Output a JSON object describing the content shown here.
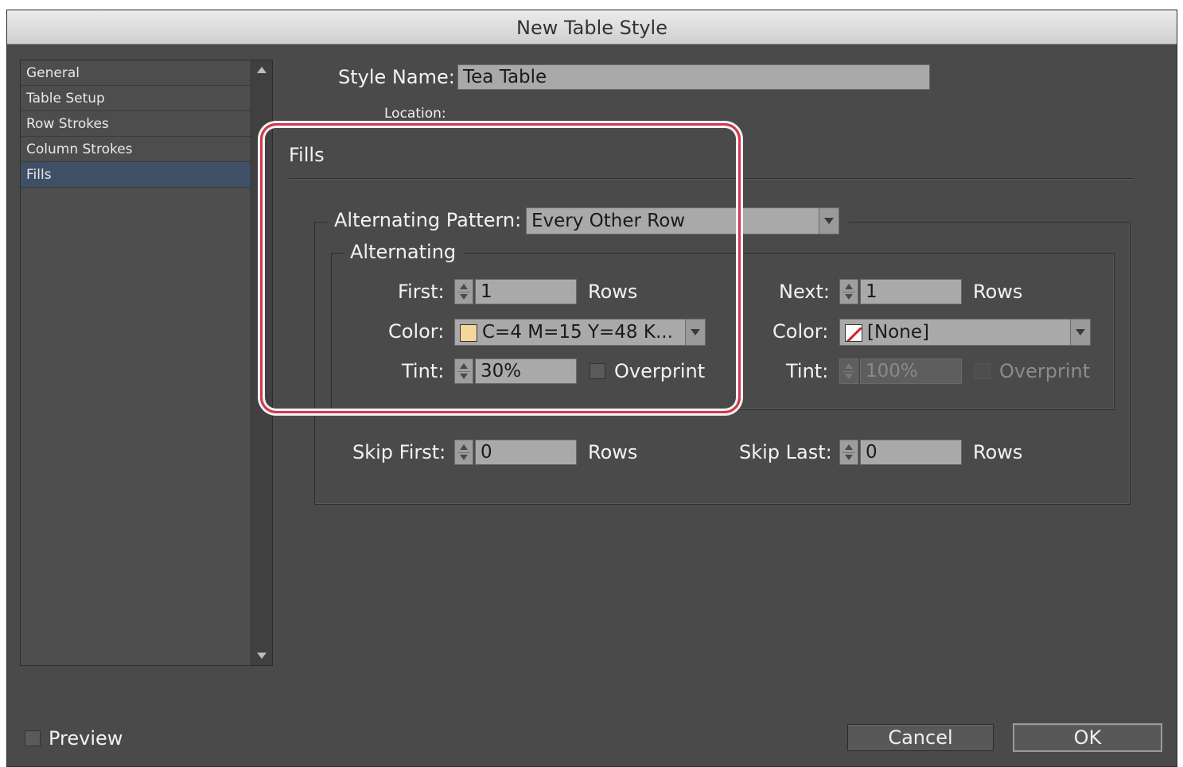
{
  "window": {
    "title": "New Table Style"
  },
  "sidebar": {
    "items": [
      {
        "label": "General",
        "selected": false
      },
      {
        "label": "Table Setup",
        "selected": false
      },
      {
        "label": "Row Strokes",
        "selected": false
      },
      {
        "label": "Column Strokes",
        "selected": false
      },
      {
        "label": "Fills",
        "selected": true
      }
    ]
  },
  "style_name": {
    "label": "Style Name:",
    "value": "Tea Table"
  },
  "location": {
    "label": "Location:"
  },
  "section": {
    "title": "Fills"
  },
  "pattern": {
    "label": "Alternating Pattern:",
    "value": "Every Other Row"
  },
  "alternating": {
    "title": "Alternating",
    "first": {
      "count_label": "First:",
      "count": "1",
      "unit": "Rows",
      "color_label": "Color:",
      "color": "C=4 M=15 Y=48 K...",
      "swatch": "#f6d69a",
      "tint_label": "Tint:",
      "tint": "30%",
      "overprint_label": "Overprint",
      "overprint_checked": false
    },
    "next": {
      "count_label": "Next:",
      "count": "1",
      "unit": "Rows",
      "color_label": "Color:",
      "color": "[None]",
      "swatch_icon": "none-swatch-icon",
      "tint_label": "Tint:",
      "tint": "100%",
      "overprint_label": "Overprint",
      "overprint_checked": false
    }
  },
  "skip": {
    "first_label": "Skip First:",
    "first": "0",
    "first_unit": "Rows",
    "last_label": "Skip Last:",
    "last": "0",
    "last_unit": "Rows"
  },
  "footer": {
    "preview_label": "Preview",
    "preview_checked": false,
    "cancel_label": "Cancel",
    "ok_label": "OK"
  },
  "colors": {
    "highlight": "#d2384a",
    "selected_item": "#3f5066",
    "dialog_bg": "#4a4a4a"
  }
}
